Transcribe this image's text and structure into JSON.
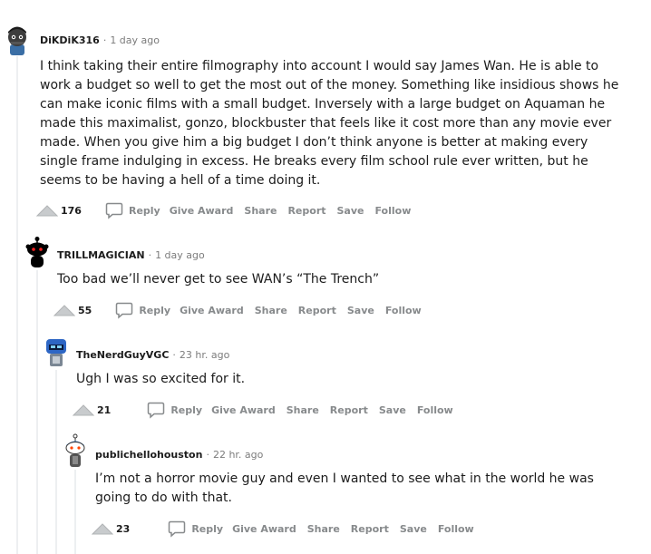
{
  "comments": [
    {
      "username": "DiKDiK316",
      "time": "1 day ago",
      "body": "I think taking their entire filmography into account I would say James Wan. He is able to work a budget so well to get the most out of the money. Something like insidious shows he can make iconic films with a small budget. Inversely with a large budget on Aquaman he made this maximalist, gonzo, blockbuster that feels like it cost more than any movie ever made. When you give him a big budget I don’t think anyone is better at making every single frame indulging in excess. He breaks every film school rule ever written, but he seems to be having a hell of a time doing it.",
      "score": "176"
    },
    {
      "username": "TRILLMAGICIAN",
      "time": "1 day ago",
      "body": "Too bad we’ll never get to see WAN’s “The Trench”",
      "score": "55"
    },
    {
      "username": "TheNerdGuyVGC",
      "time": "23 hr. ago",
      "body": "Ugh I was so excited for it.",
      "score": "21"
    },
    {
      "username": "publichellohouston",
      "time": "22 hr. ago",
      "body": "I’m not a horror movie guy and even I wanted to see what in the world he was going to do with that.",
      "score": "23"
    }
  ],
  "actions": {
    "reply": "Reply",
    "give_award": "Give Award",
    "share": "Share",
    "report": "Report",
    "save": "Save",
    "follow": "Follow"
  },
  "meta_separator": "·",
  "icons": {
    "upvote": "upvote-arrow-icon",
    "reply": "comment-bubble-icon",
    "avatar": "user-avatar-icon"
  },
  "colors": {
    "text": "#1c1c1c",
    "muted": "#7c7c7c",
    "action": "#878a8c",
    "thread_line": "#edeff1",
    "upvote_fill": "#c8cbcd"
  }
}
